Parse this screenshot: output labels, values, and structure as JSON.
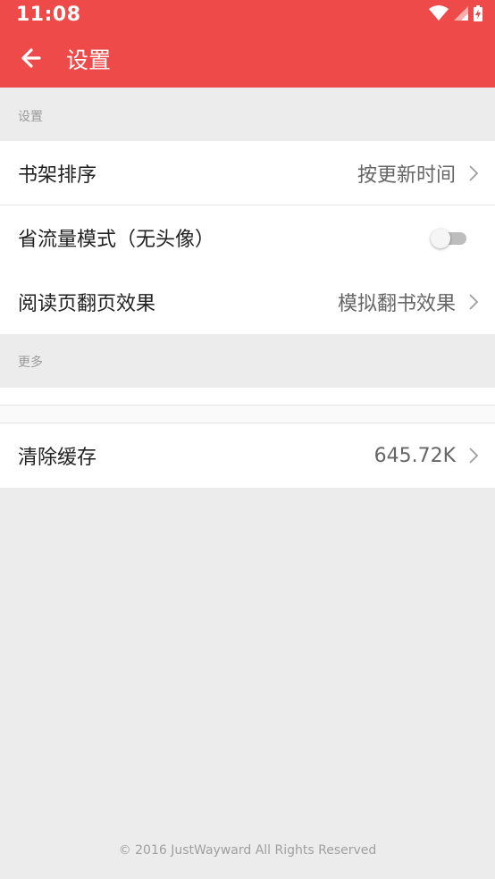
{
  "status_bar": {
    "time": "11:08",
    "icons": [
      "wifi-icon",
      "cell-signal-icon",
      "battery-charging-icon"
    ]
  },
  "toolbar": {
    "title": "设置",
    "back_icon": "arrow-left-icon"
  },
  "sections": {
    "settings_header": "设置",
    "more_header": "更多"
  },
  "settings": {
    "shelf_sort": {
      "label": "书架排序",
      "value": "按更新时间"
    },
    "data_saver": {
      "label": "省流量模式（无头像）",
      "enabled": false
    },
    "page_turn": {
      "label": "阅读页翻页效果",
      "value": "模拟翻书效果"
    }
  },
  "more": {
    "clear_cache": {
      "label": "清除缓存",
      "value": "645.72K"
    }
  },
  "footer": "© 2016 JustWayward All Rights Reserved",
  "colors": {
    "accent": "#ef4a4a",
    "background": "#ececec"
  }
}
